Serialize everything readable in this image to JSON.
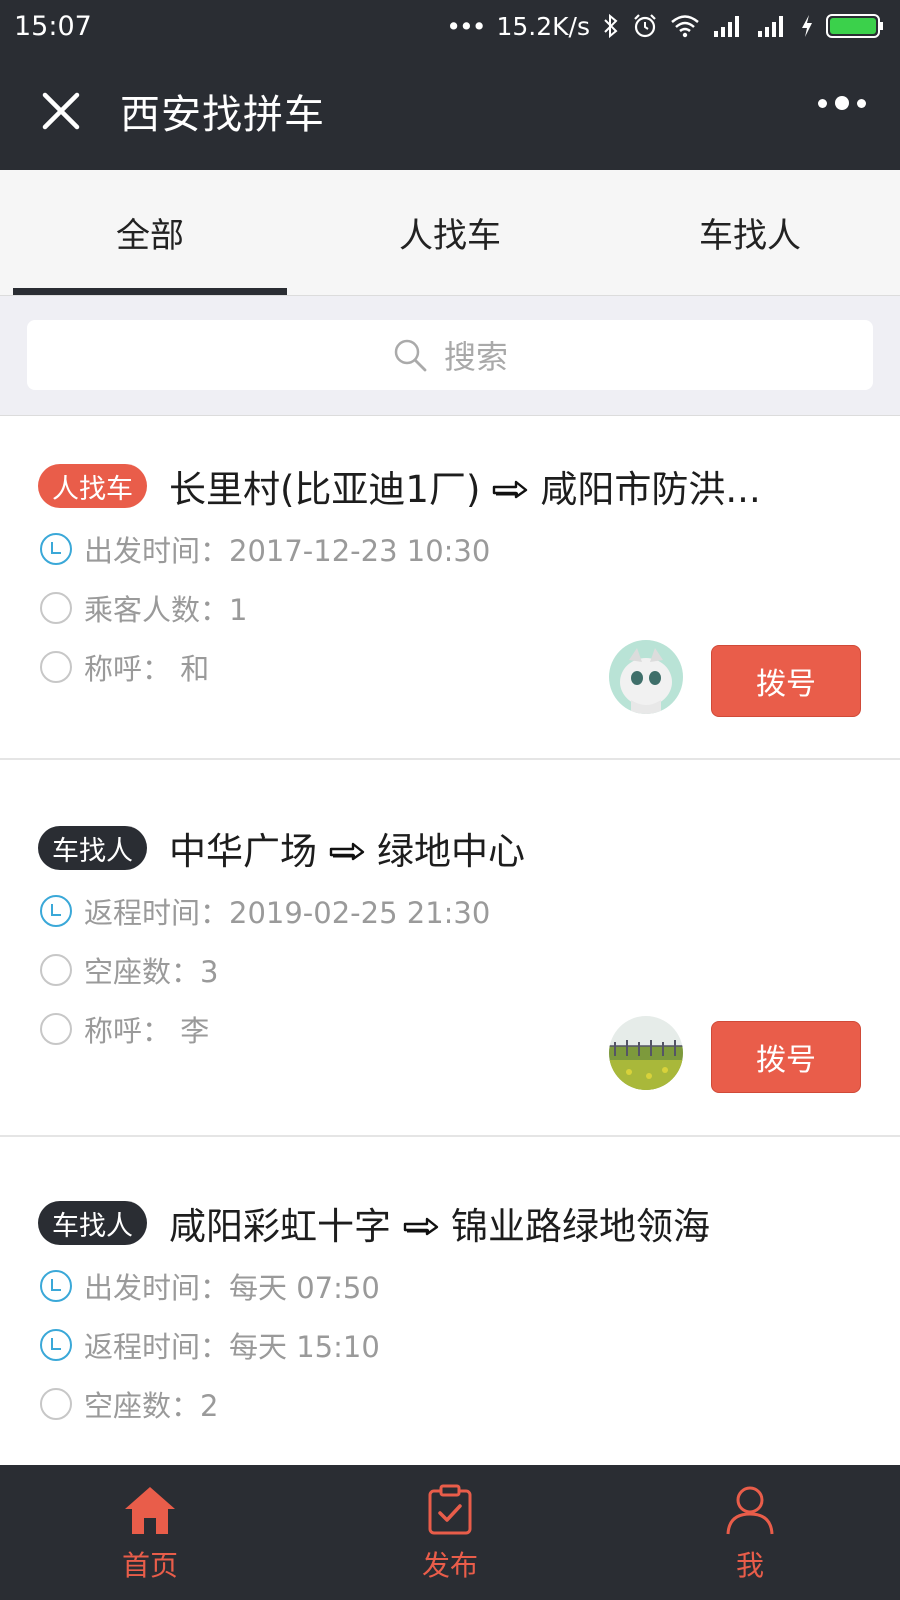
{
  "status_bar": {
    "time": "15:07",
    "dots": "•••",
    "speed": "15.2K/s"
  },
  "title_bar": {
    "title": "西安找拼车"
  },
  "tabs": [
    {
      "label": "全部",
      "active": true
    },
    {
      "label": "人找车",
      "active": false
    },
    {
      "label": "车找人",
      "active": false
    }
  ],
  "search": {
    "placeholder": "搜索"
  },
  "cards": [
    {
      "tag": "人找车",
      "tag_color": "#e95d4a",
      "from": "长里村(比亚迪1厂)",
      "to": "咸阳市防洪...",
      "rows": [
        {
          "icon": "clock-icon",
          "text": "出发时间：2017-12-23 10:30"
        },
        {
          "icon": "circle-icon",
          "text": "乘客人数：1"
        },
        {
          "icon": "circle-icon",
          "text": "称呼：  和"
        }
      ],
      "dial_label": "拨号"
    },
    {
      "tag": "车找人",
      "tag_color": "#2a2d33",
      "from": "中华广场",
      "to": "绿地中心",
      "rows": [
        {
          "icon": "clock-icon",
          "text": "返程时间：2019-02-25 21:30"
        },
        {
          "icon": "circle-icon",
          "text": "空座数：3"
        },
        {
          "icon": "circle-icon",
          "text": "称呼：  李"
        }
      ],
      "dial_label": "拨号"
    },
    {
      "tag": "车找人",
      "tag_color": "#2a2d33",
      "from": "咸阳彩虹十字",
      "to": "锦业路绿地领海",
      "rows": [
        {
          "icon": "clock-icon",
          "text": "出发时间：每天 07:50"
        },
        {
          "icon": "clock-icon",
          "text": "返程时间：每天 15:10"
        },
        {
          "icon": "circle-icon",
          "text": "空座数：2"
        }
      ]
    }
  ],
  "bottom_nav": [
    {
      "label": "首页",
      "icon": "home-icon"
    },
    {
      "label": "发布",
      "icon": "publish-icon"
    },
    {
      "label": "我",
      "icon": "user-icon"
    }
  ],
  "colors": {
    "accent": "#e95d4a",
    "dark": "#2a2d33",
    "clock": "#3aa8d8"
  }
}
